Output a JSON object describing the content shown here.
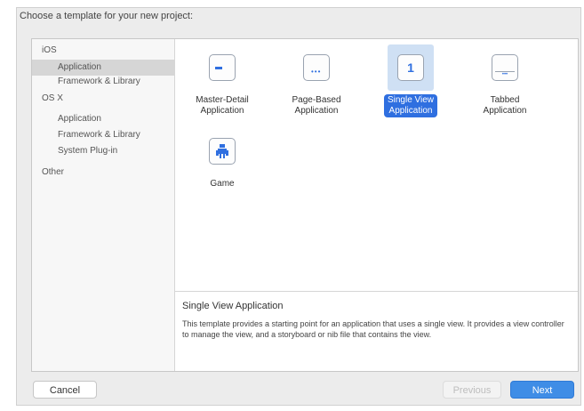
{
  "dialog": {
    "header": "Choose a template for your new project:"
  },
  "sidebar": {
    "items": [
      {
        "label": "iOS",
        "type": "group"
      },
      {
        "label": "Application",
        "type": "child",
        "selected": true
      },
      {
        "label": "Framework & Library",
        "type": "child"
      },
      {
        "label": "OS X",
        "type": "group"
      },
      {
        "label": "Application",
        "type": "child"
      },
      {
        "label": "Framework & Library",
        "type": "child"
      },
      {
        "label": "System Plug-in",
        "type": "child"
      },
      {
        "label": "Other",
        "type": "group"
      }
    ]
  },
  "templates": [
    {
      "name": "Master-Detail Application",
      "line1": "Master-Detail",
      "line2": "Application",
      "icon": "master-detail-icon"
    },
    {
      "name": "Page-Based Application",
      "line1": "Page-Based",
      "line2": "Application",
      "icon": "page-based-icon"
    },
    {
      "name": "Single View Application",
      "line1": "Single View",
      "line2": "Application",
      "icon": "single-view-icon",
      "glyph": "1",
      "selected": true
    },
    {
      "name": "Tabbed Application",
      "line1": "Tabbed",
      "line2": "Application",
      "icon": "tabbed-icon"
    },
    {
      "name": "Game",
      "line1": "Game",
      "line2": "",
      "icon": "game-icon"
    }
  ],
  "description": {
    "title": "Single View Application",
    "text": "This template provides a starting point for an application that uses a single view. It provides a view controller to manage the view, and a storyboard or nib file that contains the view."
  },
  "buttons": {
    "cancel": "Cancel",
    "previous": "Previous",
    "next": "Next"
  },
  "colors": {
    "accent": "#2f6fe0",
    "selection_bg": "#cfe0f4",
    "next_button": "#3f8de6"
  }
}
